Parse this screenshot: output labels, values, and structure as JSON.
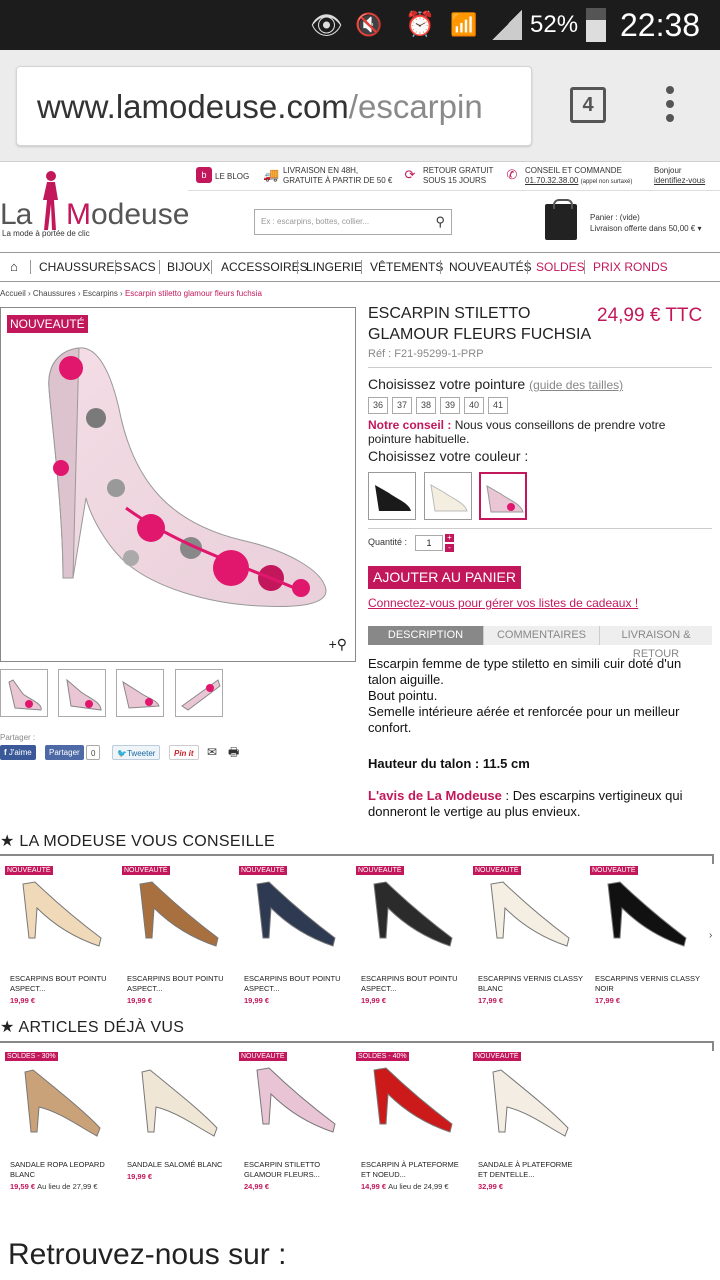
{
  "status_bar": {
    "battery": "52%",
    "time": "22:38"
  },
  "browser": {
    "url_host": "www.lamodeuse.com",
    "url_path": "/escarpin",
    "tab_count": "4"
  },
  "top_strip": {
    "blog": "LE BLOG",
    "delivery_l1": "LIVRAISON EN 48H,",
    "delivery_l2": "GRATUITE À PARTIR DE 50 €",
    "return_l1": "RETOUR GRATUIT",
    "return_l2": "SOUS 15 JOURS",
    "advice_l1": "CONSEIL ET COMMANDE",
    "phone": "01.70.32.38.00",
    "phone_note": "(appel non surtaxé)",
    "hello": "Bonjour",
    "login": "identifiez-vous"
  },
  "logo": {
    "la": "La",
    "m": "M",
    "rest": "odeuse",
    "tagline": "La mode à portée de clic"
  },
  "search": {
    "placeholder": "Ex : escarpins, bottes, collier..."
  },
  "cart": {
    "line1": "Panier : (vide)",
    "line2": "Livraison offerte dans 50,00 €"
  },
  "nav": {
    "items": [
      "CHAUSSURES",
      "SACS",
      "BIJOUX",
      "ACCESSOIRES",
      "LINGERIE",
      "VÊTEMENTS",
      "NOUVEAUTÉS",
      "SOLDES",
      "PRIX RONDS"
    ]
  },
  "breadcrumb": {
    "home": "Accueil",
    "c1": "Chaussures",
    "c2": "Escarpins",
    "current": "Escarpin stiletto glamour fleurs fuchsia",
    "sep": " › "
  },
  "product": {
    "badge": "NOUVEAUTÉ",
    "title_l1": "ESCARPIN STILETTO",
    "title_l2": "GLAMOUR FLEURS FUCHSIA",
    "price": "24,99 € TTC",
    "ref": "Réf : F21-95299-1-PRP",
    "size_label": "Choisissez votre pointure",
    "size_guide": "(guide des tailles)",
    "sizes": [
      "36",
      "37",
      "38",
      "39",
      "40",
      "41"
    ],
    "advice_label": "Notre conseil :",
    "advice_text": " Nous vous conseillons de prendre votre pointure habituelle.",
    "color_label": "Choisissez votre couleur :",
    "qty_label": "Quantité :",
    "qty": "1",
    "add_to_cart": "AJOUTER AU PANIER",
    "wishlist": "Connectez-vous pour gérer vos listes de cadeaux !",
    "tabs": [
      "DESCRIPTION",
      "COMMENTAIRES",
      "LIVRAISON & RETOUR"
    ],
    "desc1": "Escarpin femme de type stiletto en simili cuir doté d'un talon aiguille.",
    "desc2": "Bout pointu.",
    "desc3": "Semelle intérieure aérée et renforcée pour un meilleur confort.",
    "heel": "Hauteur du talon : 11.5 cm",
    "avis_label": "L'avis de La Modeuse",
    "avis_text": " : Des escarpins vertigineux qui donneront le vertige au plus envieux."
  },
  "share": {
    "label": "Partager :",
    "like": "J'aime",
    "share_fb": "Partager",
    "count": "0",
    "tweet": "Tweeter",
    "pin": "Pin it"
  },
  "sections": {
    "recommend": "LA MODEUSE VOUS CONSEILLE",
    "seen": "ARTICLES DÉJÀ VUS",
    "follow": "Retrouvez-nous sur :"
  },
  "recommend": [
    {
      "badge": "NOUVEAUTÉ",
      "name1": "ESCARPINS BOUT POINTU",
      "name2": "ASPECT...",
      "price": "19,99 €",
      "color": "#efd9b8"
    },
    {
      "badge": "NOUVEAUTÉ",
      "name1": "ESCARPINS BOUT POINTU",
      "name2": "ASPECT...",
      "price": "19,99 €",
      "color": "#a8703f"
    },
    {
      "badge": "NOUVEAUTÉ",
      "name1": "ESCARPINS BOUT POINTU",
      "name2": "ASPECT...",
      "price": "19,99 €",
      "color": "#2e3a52"
    },
    {
      "badge": "NOUVEAUTÉ",
      "name1": "ESCARPINS BOUT POINTU",
      "name2": "ASPECT...",
      "price": "19,99 €",
      "color": "#2b2b2b"
    },
    {
      "badge": "NOUVEAUTÉ",
      "name1": "ESCARPINS VERNIS CLASSY",
      "name2": "BLANC",
      "price": "17,99 €",
      "color": "#f4efe2"
    },
    {
      "badge": "NOUVEAUTÉ",
      "name1": "ESCARPINS VERNIS CLASSY",
      "name2": "NOIR",
      "price": "17,99 €",
      "color": "#111111"
    }
  ],
  "seen": [
    {
      "badge": "SOLDES - 30%",
      "name1": "SANDALE ROPA LEOPARD",
      "name2": "BLANC",
      "price": "19,59 €",
      "old": "Au lieu de 27,99 €",
      "color": "#c9a27a"
    },
    {
      "badge": "",
      "name1": "SANDALE SALOMÉ BLANC",
      "name2": "",
      "price": "19,99 €",
      "old": "",
      "color": "#f0e6d6"
    },
    {
      "badge": "NOUVEAUTÉ",
      "name1": "ESCARPIN STILETTO",
      "name2": "GLAMOUR FLEURS...",
      "price": "24,99 €",
      "old": "",
      "color": "#e8c4d4"
    },
    {
      "badge": "SOLDES - 40%",
      "name1": "ESCARPIN À PLATEFORME",
      "name2": "ET NOEUD...",
      "price": "14,99 €",
      "old": "Au lieu de 24,99 €",
      "color": "#cc1a1a"
    },
    {
      "badge": "NOUVEAUTÉ",
      "name1": "SANDALE À PLATEFORME",
      "name2": "ET DENTELLE...",
      "price": "32,99 €",
      "old": "",
      "color": "#f3ede3"
    }
  ],
  "colors": {
    "accent": "#c2185b",
    "text": "#222222"
  }
}
